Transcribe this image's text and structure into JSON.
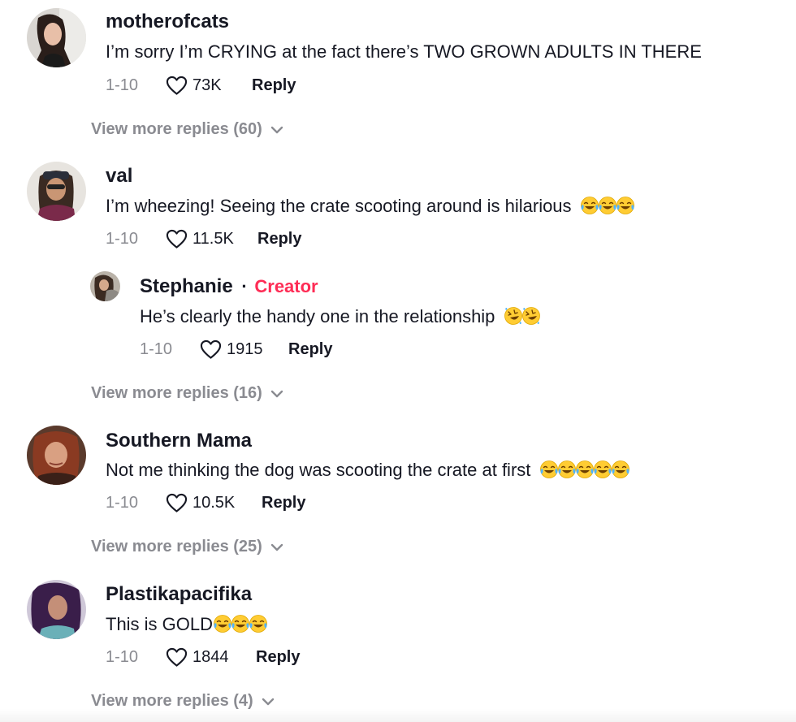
{
  "comments": [
    {
      "username": "motherofcats",
      "text": "I’m sorry I’m CRYING at the fact there’s TWO GROWN ADULTS IN THERE",
      "date": "1-10",
      "likes": "73K",
      "reply_label": "Reply",
      "view_more": "View more replies (60)"
    },
    {
      "username": "val",
      "text": "I’m wheezing! Seeing the crate scooting around is hilarious",
      "emojis": [
        "face-with-tears-of-joy-icon",
        "face-with-tears-of-joy-icon",
        "face-with-tears-of-joy-icon"
      ],
      "date": "1-10",
      "likes": "11.5K",
      "reply_label": "Reply",
      "reply": {
        "username": "Stephanie",
        "separator": "·",
        "badge": "Creator",
        "text": "He’s clearly the handy one in the relationship",
        "emojis": [
          "rolling-on-floor-laughing-icon",
          "rolling-on-floor-laughing-icon"
        ],
        "date": "1-10",
        "likes": "1915",
        "reply_label": "Reply"
      },
      "view_more": "View more replies (16)"
    },
    {
      "username": "Southern Mama",
      "text": "Not me thinking the dog was scooting the crate at first",
      "emojis": [
        "face-with-tears-of-joy-icon",
        "face-with-tears-of-joy-icon",
        "face-with-tears-of-joy-icon",
        "face-with-tears-of-joy-icon",
        "face-with-tears-of-joy-icon"
      ],
      "date": "1-10",
      "likes": "10.5K",
      "reply_label": "Reply",
      "view_more": "View more replies (25)"
    },
    {
      "username": "Plastikapacifika",
      "text": "This is GOLD",
      "emojis": [
        "face-with-tears-of-joy-icon",
        "face-with-tears-of-joy-icon",
        "face-with-tears-of-joy-icon"
      ],
      "date": "1-10",
      "likes": "1844",
      "reply_label": "Reply",
      "view_more": "View more replies (4)"
    }
  ],
  "colors": {
    "creator_badge": "#fe2c55",
    "muted_text": "#8a8b91",
    "primary_text": "#161823"
  }
}
